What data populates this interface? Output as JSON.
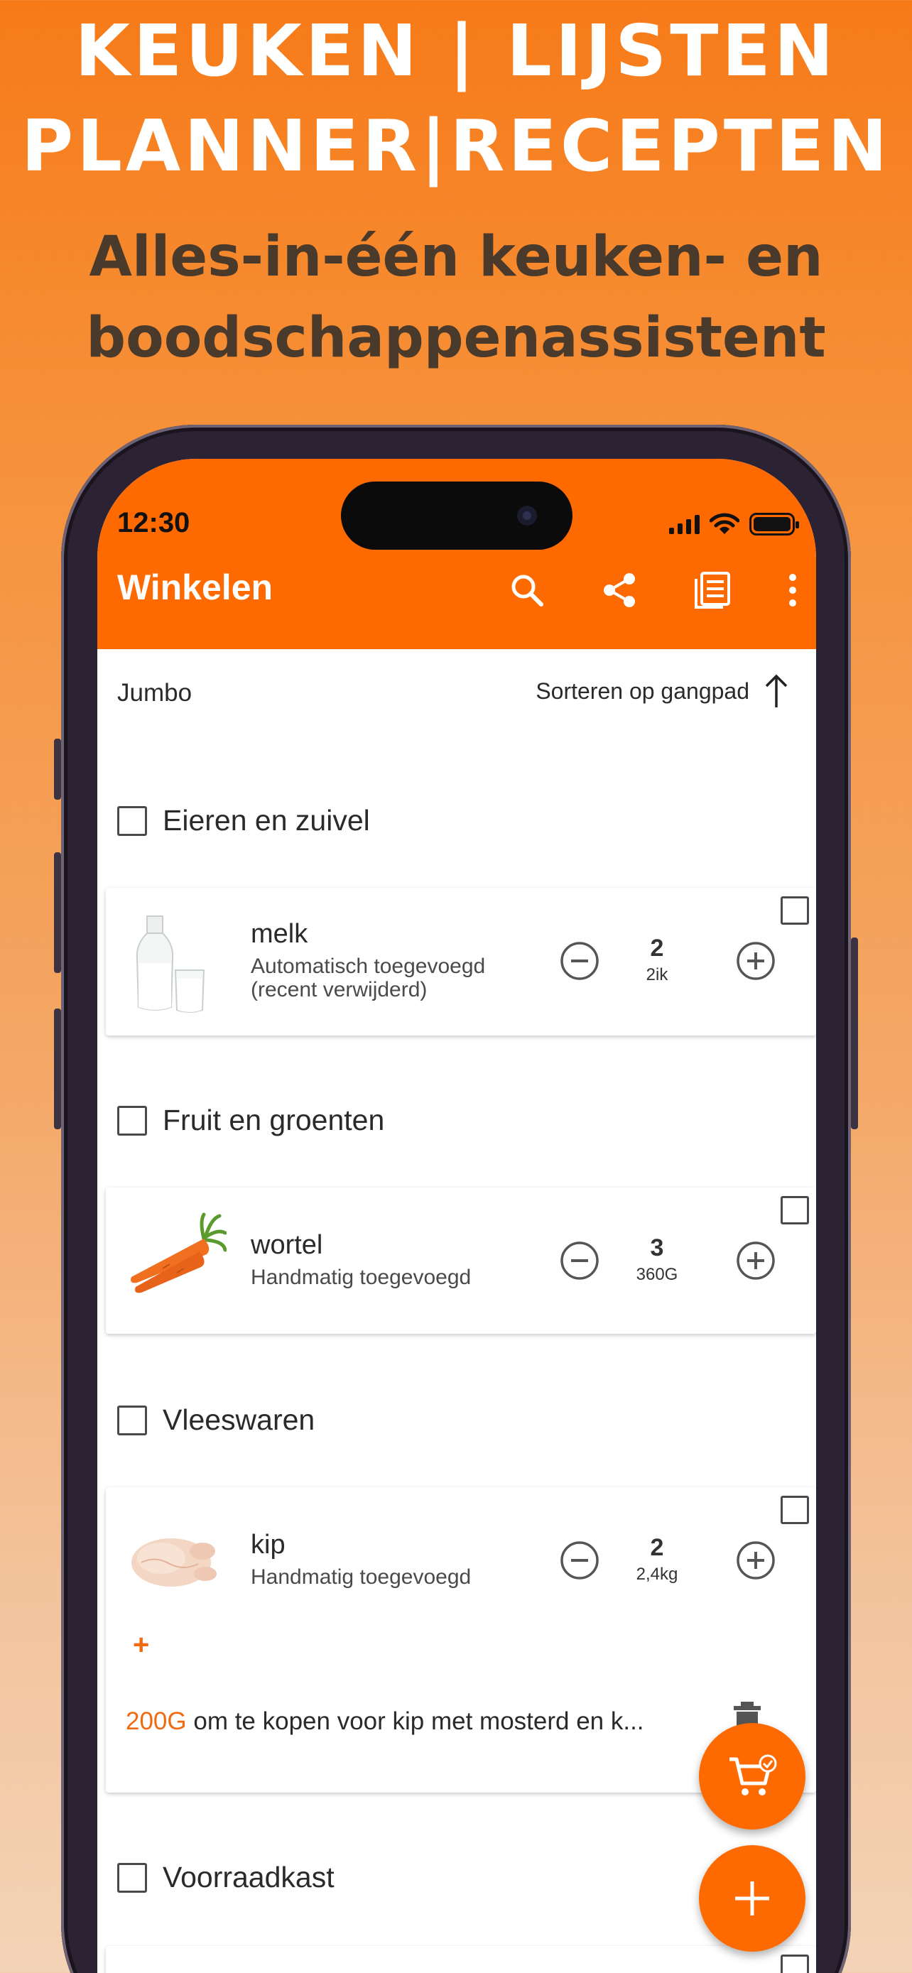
{
  "promo": {
    "headline_line1": "KEUKEN | LIJSTEN",
    "headline_line2": "PLANNER|RECEPTEN",
    "subtitle_line1": "Alles-in-één keuken- en",
    "subtitle_line2": "boodschappenassistent"
  },
  "status_bar": {
    "time": "12:30"
  },
  "app_bar": {
    "title": "Winkelen",
    "icons": [
      "search-icon",
      "share-icon",
      "list-view-icon",
      "more-vert-icon"
    ]
  },
  "list_header": {
    "store": "Jumbo",
    "sort_label": "Sorteren op gangpad",
    "sort_icon": "arrow-up-icon"
  },
  "sections": [
    {
      "name": "Eieren en zuivel",
      "items": [
        {
          "name": "melk",
          "note": "Automatisch toegevoegd (recent verwijderd)",
          "quantity": "2",
          "unit": "2ik",
          "image": "milk"
        }
      ]
    },
    {
      "name": "Fruit en groenten",
      "items": [
        {
          "name": "wortel",
          "note": "Handmatig toegevoegd",
          "quantity": "3",
          "unit": "360G",
          "image": "carrot"
        }
      ]
    },
    {
      "name": "Vleeswaren",
      "items": [
        {
          "name": "kip",
          "note": "Handmatig toegevoegd",
          "quantity": "2",
          "unit": "2,4kg",
          "image": "chicken",
          "add_label": "+",
          "recipe_amount": "200G",
          "recipe_text": "om te kopen voor kip met mosterd en k..."
        }
      ]
    },
    {
      "name": "Voorraadkast",
      "items": []
    }
  ],
  "fabs": [
    "cart-check-icon",
    "add-icon"
  ],
  "colors": {
    "accent": "#ff6a00",
    "text": "#2a2a2a",
    "subtitle": "#4a3a2c"
  }
}
